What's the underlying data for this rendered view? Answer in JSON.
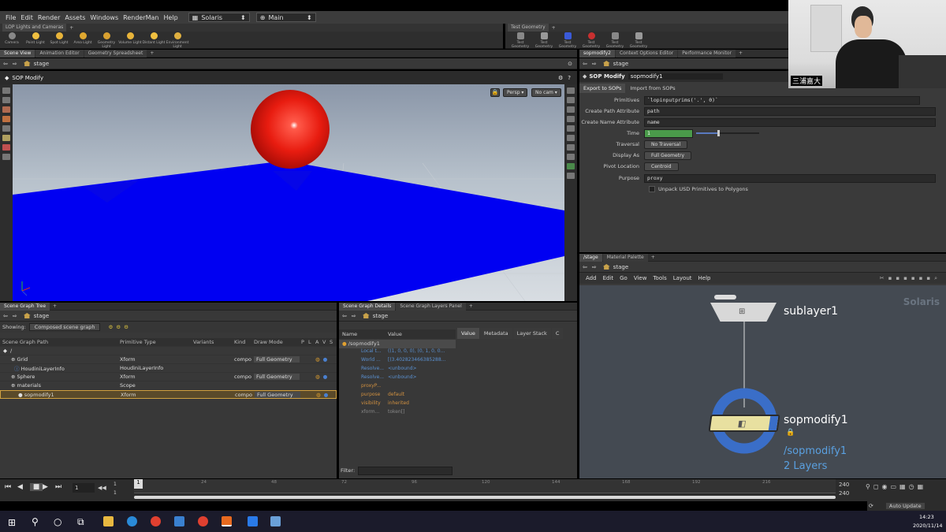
{
  "menu": {
    "items": [
      "File",
      "Edit",
      "Render",
      "Assets",
      "Windows",
      "RenderMan",
      "Help"
    ],
    "desktop": "Solaris",
    "context": "Main"
  },
  "shelf": {
    "left_tab": "LOP Lights and Cameras",
    "left_tools": [
      "Camera",
      "Point Light",
      "Spot Light",
      "Area Light",
      "Geometry Light",
      "Volume Light",
      "Distant Light",
      "Environment Light"
    ],
    "right_tab": "Test Geometry",
    "right_tools": [
      "Test Geometry",
      "Test Geometry",
      "Test Geometry",
      "Test Geometry",
      "Test Geometry",
      "Test Geometry"
    ]
  },
  "left_pane": {
    "tabs": [
      "Scene View",
      "Animation Editor",
      "Geometry Spreadsheet"
    ],
    "path": "stage",
    "viewer_title": "SOP Modify",
    "persp": "Persp ▾",
    "nocam": "No cam ▾"
  },
  "parm_pane": {
    "tabs": [
      "sopmodify2",
      "Context Options Editor",
      "Performance Monitor"
    ],
    "path": "stage",
    "node_type": "SOP Modify",
    "node_name": "sopmodify1",
    "subtabs": [
      "Export to SOPs",
      "Import from SOPs"
    ],
    "params": {
      "primitives_label": "Primitives",
      "primitives_value": "`lopinputprims('.', 0)`",
      "create_path_label": "Create Path Attribute",
      "create_path_value": "path",
      "create_name_label": "Create Name Attribute",
      "create_name_value": "name",
      "time_label": "Time",
      "time_value": "1",
      "traversal_label": "Traversal",
      "traversal_value": "No Traversal",
      "display_label": "Display As",
      "display_value": "Full Geometry",
      "pivot_label": "Pivot Location",
      "pivot_value": "Centroid",
      "purpose_label": "Purpose",
      "purpose_value": "proxy",
      "unpack_label": "Unpack USD Primitives to Polygons"
    }
  },
  "network": {
    "tabs": [
      "/stage",
      "Material Palette"
    ],
    "path": "stage",
    "menu": [
      "Add",
      "Edit",
      "Go",
      "View",
      "Tools",
      "Layout",
      "Help"
    ],
    "watermark": "Solaris",
    "node1": "sublayer1",
    "node2": "sopmodify1",
    "node2_path": "/sopmodify1",
    "node2_layers": "2 Layers"
  },
  "scene_graph": {
    "tab": "Scene Graph Tree",
    "path": "stage",
    "showing_label": "Showing:",
    "showing_value": "Composed scene graph",
    "columns": [
      "Scene Graph Path",
      "Primitive Type",
      "Variants",
      "Kind",
      "Draw Mode",
      "P",
      "L",
      "A",
      "V",
      "S"
    ],
    "root": "/",
    "rows": [
      {
        "name": "Grid",
        "type": "Xform",
        "kind": "compo",
        "draw": "Full Geometry"
      },
      {
        "name": "HoudiniLayerInfo",
        "type": "HoudiniLayerInfo",
        "kind": "",
        "draw": ""
      },
      {
        "name": "Sphere",
        "type": "Xform",
        "kind": "compo",
        "draw": "Full Geometry"
      },
      {
        "name": "materials",
        "type": "Scope",
        "kind": "",
        "draw": ""
      },
      {
        "name": "sopmodify1",
        "type": "Xform",
        "kind": "compo",
        "draw": "Full Geometry"
      }
    ]
  },
  "details": {
    "tabs": [
      "Scene Graph Details",
      "Scene Graph Layers Panel"
    ],
    "path": "stage",
    "columns": [
      "Name",
      "Value"
    ],
    "right_tabs": [
      "Value",
      "Metadata",
      "Layer Stack",
      "C"
    ],
    "prim": "/sopmodify1",
    "rows": [
      {
        "name": "Local t...",
        "value": "((1, 0, 0, 0), (0, 1, 0, 0..."
      },
      {
        "name": "World ...",
        "value": "[(3.402823466385288..."
      },
      {
        "name": "Resolve...",
        "value": "<unbound>"
      },
      {
        "name": "Resolve...",
        "value": "<unbound>"
      },
      {
        "name": "proxyP...",
        "value": ""
      },
      {
        "name": "purpose",
        "value": "default"
      },
      {
        "name": "visibility",
        "value": "inherited"
      },
      {
        "name": "xform...",
        "value": "token[]"
      }
    ],
    "filter_label": "Filter:"
  },
  "timeline": {
    "frame": "1",
    "start": "1",
    "start2": "1",
    "ticks": [
      "24",
      "48",
      "72",
      "96",
      "120",
      "144",
      "168",
      "192",
      "216"
    ],
    "end": "240",
    "end2": "240",
    "marker": "1",
    "auto_update": "Auto Update"
  },
  "taskbar": {
    "time": "14:23",
    "date": "2020/11/14"
  },
  "webcam": {
    "name": "三浦嘉大"
  }
}
